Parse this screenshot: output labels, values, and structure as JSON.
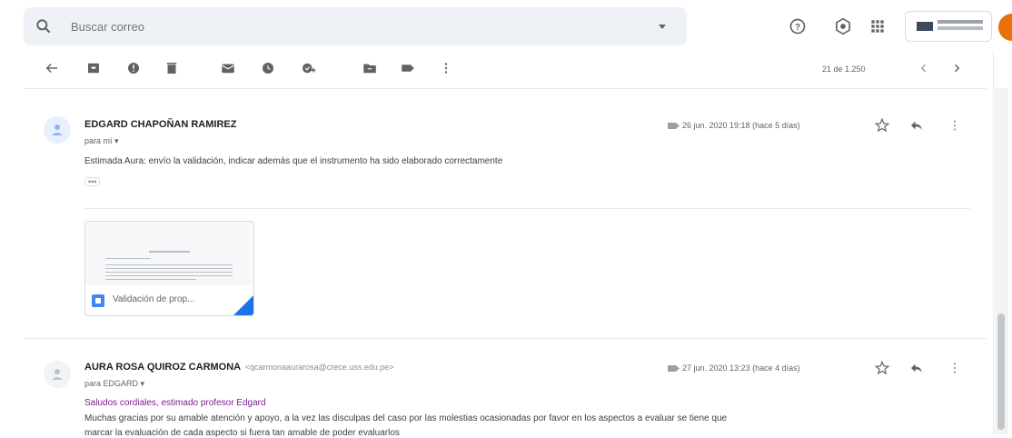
{
  "search": {
    "placeholder": "Buscar correo"
  },
  "topbar": {
    "icons": [
      "search-icon",
      "caret-down-icon",
      "help-icon",
      "settings-icon",
      "apps-grid-icon"
    ],
    "logo": "institution-logo",
    "accent": "#e8710a"
  },
  "toolbar": {
    "icons": [
      "back-arrow-icon",
      "archive-icon",
      "report-spam-icon",
      "delete-icon",
      "mark-unread-icon",
      "snooze-icon",
      "add-task-icon",
      "move-to-icon",
      "label-icon",
      "more-vert-icon"
    ],
    "pager": "21 de 1.250"
  },
  "messages": [
    {
      "sender": "EDGARD CHAPOÑAN RAMIREZ",
      "email": "",
      "recipient": "para mí",
      "date": "26 jun. 2020 19:18 (hace 5 días)",
      "body": "Estimada Aura: envío la validación, indicar además que el instrumento ha sido elaborado correctamente",
      "ellipsis": "•••",
      "attachment": {
        "name": "Validación de prop..."
      }
    },
    {
      "sender": "AURA ROSA QUIROZ CARMONA",
      "email": "<qcarmonaaurarosa@crece.uss.edu.pe>",
      "recipient": "para EDGARD",
      "date": "27 jun. 2020 13:23 (hace 4 días)",
      "greeting": "Saludos cordiales, estimado profesor Edgard",
      "body_line1": "Muchas gracias por su amable atención y apoyo, a la vez las disculpas del caso por las molestias ocasionadas por favor en los aspectos a evaluar se tiene que",
      "body_line2": "marcar la evaluación de cada aspecto si fuera tan amable de poder evaluarlos"
    }
  ],
  "colors": {
    "link_blue": "#1a73e8",
    "purple_text": "#7a1f8f"
  }
}
